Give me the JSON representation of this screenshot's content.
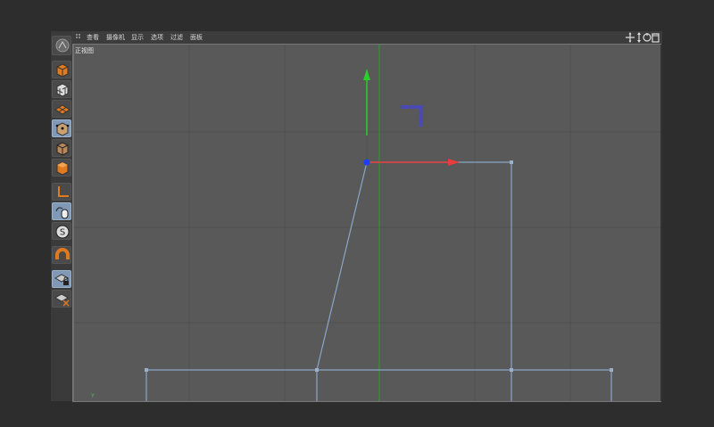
{
  "menubar": {
    "items": [
      "查看",
      "摄像机",
      "显示",
      "选项",
      "过滤",
      "面板"
    ]
  },
  "viewport": {
    "view_label": "正视图",
    "axis_label": "Y"
  },
  "toolbar": {
    "tools": [
      {
        "name": "model-mode",
        "icon": "cube-icon"
      },
      {
        "name": "texture-mode",
        "icon": "checker-cube-icon"
      },
      {
        "name": "workplane-mode",
        "icon": "grid-plane-icon"
      },
      {
        "name": "points-mode",
        "icon": "points-cube-icon",
        "active": true
      },
      {
        "name": "edges-mode",
        "icon": "edges-cube-icon"
      },
      {
        "name": "polygons-mode",
        "icon": "polygon-cube-icon"
      },
      {
        "name": "axis-mode",
        "icon": "axis-icon"
      },
      {
        "name": "tweak-mode",
        "icon": "mouse-icon",
        "active": true
      },
      {
        "name": "solo-mode",
        "icon": "solo-icon"
      },
      {
        "name": "snap",
        "icon": "magnet-icon"
      },
      {
        "name": "lock-workplane",
        "icon": "lock-grid-icon"
      },
      {
        "name": "planar-workplane",
        "icon": "grid-planar-icon"
      }
    ]
  },
  "colors": {
    "accent_active": "#7f99b6",
    "x_axis": "#e83c3c",
    "y_axis": "#2ecc2e",
    "spline": "#8aa6c8",
    "selected_point": "#1f3dff"
  }
}
